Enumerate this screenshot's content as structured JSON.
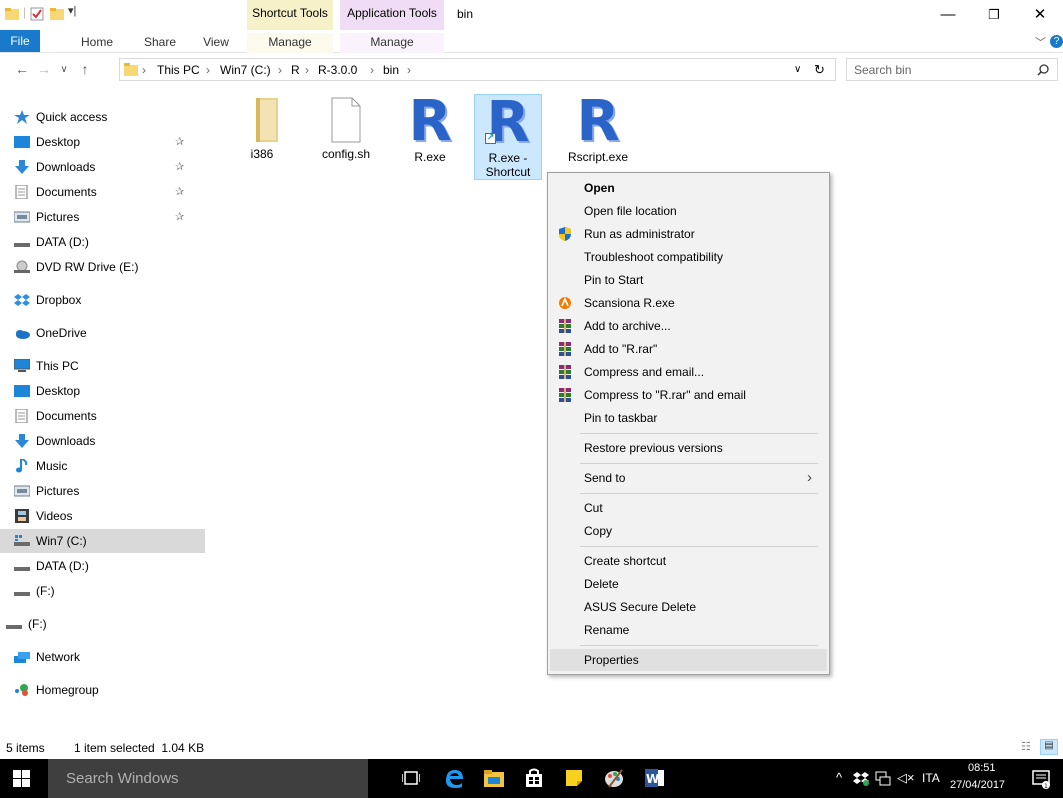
{
  "titlebar": {
    "title": "bin",
    "contextual_tabs": {
      "shortcut_tools": "Shortcut Tools",
      "application_tools": "Application Tools"
    },
    "buttons": {
      "minimize": "—",
      "restore": "❐",
      "close": "✕"
    }
  },
  "ribbon": {
    "tabs": [
      "File",
      "Home",
      "Share",
      "View",
      "Manage",
      "Manage"
    ]
  },
  "address": {
    "crumbs": [
      "This PC",
      "Win7 (C:)",
      "R",
      "R-3.0.0",
      "bin"
    ],
    "search_placeholder": "Search bin"
  },
  "nav": {
    "items": [
      {
        "label": "Quick access",
        "icon": "star-icon",
        "pinned": false
      },
      {
        "label": "Desktop",
        "icon": "desktop-icon",
        "pinned": true
      },
      {
        "label": "Downloads",
        "icon": "download-icon",
        "pinned": true
      },
      {
        "label": "Documents",
        "icon": "documents-icon",
        "pinned": true
      },
      {
        "label": "Pictures",
        "icon": "pictures-icon",
        "pinned": true
      },
      {
        "label": "DATA (D:)",
        "icon": "drive-icon",
        "pinned": false
      },
      {
        "label": "DVD RW Drive (E:)",
        "icon": "dvd-drive-icon",
        "pinned": false
      },
      {
        "label": "Dropbox",
        "icon": "dropbox-icon",
        "pinned": false
      },
      {
        "label": "OneDrive",
        "icon": "onedrive-icon",
        "pinned": false
      },
      {
        "label": "This PC",
        "icon": "this-pc-icon",
        "pinned": false
      },
      {
        "label": "Desktop",
        "icon": "desktop-icon",
        "pinned": false
      },
      {
        "label": "Documents",
        "icon": "documents-icon",
        "pinned": false
      },
      {
        "label": "Downloads",
        "icon": "download-icon",
        "pinned": false
      },
      {
        "label": "Music",
        "icon": "music-icon",
        "pinned": false
      },
      {
        "label": "Pictures",
        "icon": "pictures-icon",
        "pinned": false
      },
      {
        "label": "Videos",
        "icon": "videos-icon",
        "pinned": false
      },
      {
        "label": "Win7 (C:)",
        "icon": "windows-drive-icon",
        "pinned": false,
        "selected": true
      },
      {
        "label": "DATA (D:)",
        "icon": "drive-icon",
        "pinned": false
      },
      {
        "label": "(F:)",
        "icon": "drive-icon",
        "pinned": false
      },
      {
        "label": "(F:)",
        "icon": "drive-icon",
        "pinned": false
      },
      {
        "label": "Network",
        "icon": "network-icon",
        "pinned": false
      },
      {
        "label": "Homegroup",
        "icon": "homegroup-icon",
        "pinned": false
      }
    ]
  },
  "files": [
    {
      "name": "i386",
      "icon": "folder-icon"
    },
    {
      "name": "config.sh",
      "icon": "blank-file-icon"
    },
    {
      "name": "R.exe",
      "icon": "r-logo-icon"
    },
    {
      "name_line1": "R.exe -",
      "name_line2": "Shortcut",
      "icon": "r-logo-shortcut-icon",
      "selected": true
    },
    {
      "name": "Rscript.exe",
      "icon": "r-logo-icon"
    }
  ],
  "context_menu": {
    "items": [
      {
        "label": "Open",
        "bold": true
      },
      {
        "label": "Open file location"
      },
      {
        "label": "Run as administrator",
        "icon": "uac-shield-icon"
      },
      {
        "label": "Troubleshoot compatibility"
      },
      {
        "label": "Pin to Start"
      },
      {
        "label": "Scansiona R.exe",
        "icon": "avast-icon"
      },
      {
        "label": "Add to archive...",
        "icon": "winrar-icon"
      },
      {
        "label": "Add to \"R.rar\"",
        "icon": "winrar-icon"
      },
      {
        "label": "Compress and email...",
        "icon": "winrar-icon"
      },
      {
        "label": "Compress to \"R.rar\" and email",
        "icon": "winrar-icon"
      },
      {
        "label": "Pin to taskbar"
      },
      {
        "label": "Restore previous versions"
      },
      {
        "label": "Send to",
        "submenu": true
      },
      {
        "label": "Cut"
      },
      {
        "label": "Copy"
      },
      {
        "label": "Create shortcut"
      },
      {
        "label": "Delete"
      },
      {
        "label": "ASUS Secure Delete"
      },
      {
        "label": "Rename"
      },
      {
        "label": "Properties",
        "highlighted": true
      }
    ]
  },
  "status": {
    "count": "5 items",
    "selection": "1 item selected  1.04 KB"
  },
  "taskbar": {
    "search_placeholder": "Search Windows",
    "tray": {
      "lang": "ITA",
      "time": "08:51",
      "date": "27/04/2017"
    }
  }
}
